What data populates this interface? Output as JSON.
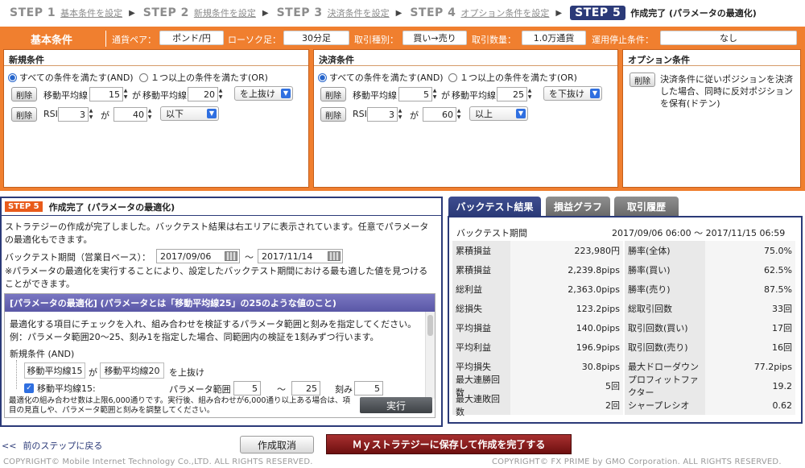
{
  "steps": [
    {
      "num": "STEP 1",
      "label": "基本条件を設定"
    },
    {
      "num": "STEP 2",
      "label": "新規条件を設定"
    },
    {
      "num": "STEP 3",
      "label": "決済条件を設定"
    },
    {
      "num": "STEP 4",
      "label": "オプション条件を設定"
    },
    {
      "num": "STEP 5",
      "label": "作成完了 (パラメータの最適化)"
    }
  ],
  "basic": {
    "title": "基本条件",
    "pair_label": "通貨ペア：",
    "pair": "ポンド/円",
    "candle_label": "ローソク足：",
    "candle": "30分足",
    "trade_label": "取引種別：",
    "trade": "買い→売り",
    "qty_label": "取引数量：",
    "qty": "1.0万通貨",
    "stop_label": "運用停止条件：",
    "stop": "なし"
  },
  "entry": {
    "title": "新規条件",
    "radio_all": "すべての条件を満たす(AND)",
    "radio_any": "１つ以上の条件を満たす(OR)",
    "delete": "削除",
    "rows": [
      {
        "ind1": "移動平均線",
        "v1": "15",
        "ga": "が",
        "ind2": "移動平均線",
        "v2": "20",
        "cond": "を上抜け"
      },
      {
        "ind1": "RSI",
        "v1": "3",
        "ga": "が",
        "ind2": "",
        "v2": "40",
        "cond": "以下"
      }
    ]
  },
  "exit": {
    "title": "決済条件",
    "radio_all": "すべての条件を満たす(AND)",
    "radio_any": "１つ以上の条件を満たす(OR)",
    "delete": "削除",
    "rows": [
      {
        "ind1": "移動平均線",
        "v1": "5",
        "ga": "が",
        "ind2": "移動平均線",
        "v2": "25",
        "cond": "を下抜け"
      },
      {
        "ind1": "RSI",
        "v1": "3",
        "ga": "が",
        "ind2": "",
        "v2": "60",
        "cond": "以上"
      }
    ]
  },
  "option": {
    "title": "オプション条件",
    "delete": "削除",
    "text": "決済条件に従いポジションを決済した場合、同時に反対ポジションを保有(ドテン)"
  },
  "step5": {
    "badge": "STEP 5",
    "title": "作成完了 (パラメータの最適化)",
    "intro": "ストラテジーの作成が完了しました。バックテスト結果は右エリアに表示されています。任意でパラメータの最適化もできます。",
    "period_label": "バックテスト期間（営業日ベース）：",
    "from": "2017/09/06",
    "tilde": "〜",
    "to": "2017/11/14",
    "note": "※パラメータの最適化を実行することにより、設定したバックテスト期間における最も適した値を見つけることができます。",
    "opt_title": "[パラメータの最適化] (パラメータとは「移動平均線25」の25のような値のこと)",
    "opt_desc1": "最適化する項目にチェックを入れ、組み合わせを検証するパラメータ範囲と刻みを指定してください。",
    "opt_desc2": "例：パラメータ範囲20〜25、刻み1を指定した場合、同範囲内の検証を1刻みずつ行います。",
    "opt_section": "新規条件 (AND)",
    "opt_ind1": "移動平均線15",
    "opt_ga": "が",
    "opt_ind2": "移動平均線20",
    "opt_cond": "を上抜け",
    "opt_check_label": "移動平均線15:",
    "opt_range_label": "パラメータ範囲",
    "opt_from": "5",
    "opt_tilde": "〜",
    "opt_to": "25",
    "opt_step_label": "刻み",
    "opt_step": "5",
    "opt_footer": "最適化の組み合わせ数は上限6,000通りです。実行後、組み合わせが6,000通り以上ある場合は、項目の見直しや、パラメータ範囲と刻みを調整してください。",
    "run": "実行"
  },
  "tabs": [
    "バックテスト結果",
    "損益グラフ",
    "取引履歴"
  ],
  "results": {
    "period_label": "バックテスト期間",
    "period": "2017/09/06 06:00 〜 2017/11/15 06:59",
    "rows": [
      {
        "l1": "累積損益",
        "v1": "223,980円",
        "l2": "勝率(全体)",
        "v2": "75.0%"
      },
      {
        "l1": "累積損益",
        "v1": "2,239.8pips",
        "l2": "勝率(買い)",
        "v2": "62.5%"
      },
      {
        "l1": "総利益",
        "v1": "2,363.0pips",
        "l2": "勝率(売り)",
        "v2": "87.5%"
      },
      {
        "l1": "総損失",
        "v1": "123.2pips",
        "l2": "総取引回数",
        "v2": "33回"
      },
      {
        "l1": "平均損益",
        "v1": "140.0pips",
        "l2": "取引回数(買い)",
        "v2": "17回"
      },
      {
        "l1": "平均利益",
        "v1": "196.9pips",
        "l2": "取引回数(売り)",
        "v2": "16回"
      },
      {
        "l1": "平均損失",
        "v1": "30.8pips",
        "l2": "最大ドローダウン",
        "v2": "77.2pips"
      },
      {
        "l1": "最大連勝回数",
        "v1": "5回",
        "l2": "プロフィットファクター",
        "v2": "19.2"
      },
      {
        "l1": "最大連敗回数",
        "v1": "2回",
        "l2": "シャープレシオ",
        "v2": "0.62"
      }
    ]
  },
  "bottom": {
    "back_arrow": "<<",
    "back": "前のステップに戻る",
    "cancel": "作成取消",
    "save": "Ｍｙストラテジーに保存して作成を完了する",
    "copy_left": "COPYRIGHT© Mobile Internet Technology Co.,LTD. ALL RIGHTS RESERVED.",
    "copy_right": "COPYRIGHT© FX PRIME by GMO Corporation. ALL RIGHTS RESERVED."
  },
  "colors": {
    "orange": "#f07f2f",
    "navy": "#2b3a78",
    "purple": "#5a57a6",
    "save": "#8a1a1a"
  }
}
